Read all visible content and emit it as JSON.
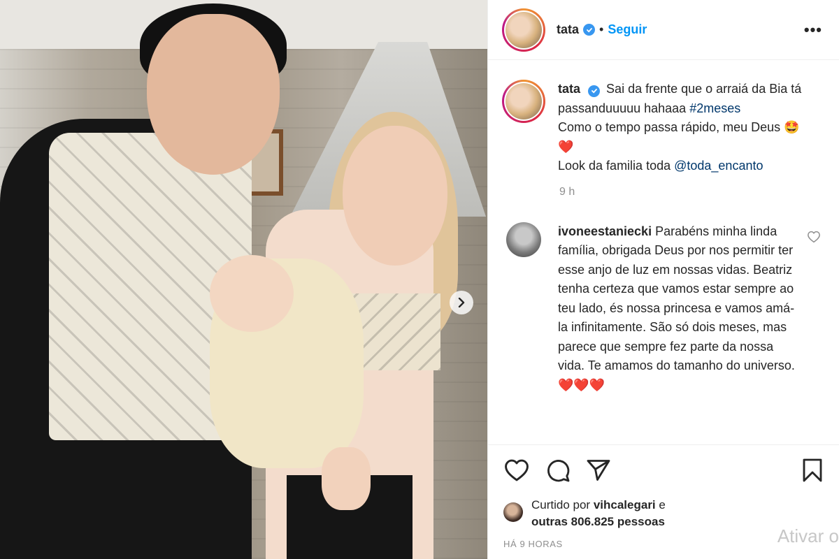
{
  "header": {
    "username": "tata",
    "separator": "•",
    "follow_label": "Seguir",
    "more_label": "•••"
  },
  "caption": {
    "username": "tata",
    "text_part1": "Sai da frente que o arraiá da Bia tá passanduuuuu hahaaa ",
    "hashtag": "#2meses",
    "line2": "Como o tempo passa rápido, meu Deus 🤩❤️",
    "line3_prefix": "Look da familia toda ",
    "mention": "@toda_encanto",
    "time": "9 h"
  },
  "comment": {
    "username": "ivoneestaniecki",
    "text": "Parabéns minha linda família, obrigada Deus por nos permitir ter esse anjo de luz em nossas vidas. Beatriz tenha certeza que vamos estar sempre ao teu lado, és nossa princesa e vamos amá-la infinitamente. São só dois meses, mas parece que sempre fez parte da nossa vida. Te amamos do tamanho do universo. ❤️❤️❤️"
  },
  "likes": {
    "prefix": "Curtido por ",
    "user": "vihcalegari",
    "conj": " e",
    "others": "outras 806.825 pessoas"
  },
  "timestamp": "HÁ 9 HORAS",
  "watermark": "Ativar o",
  "colors": {
    "accent": "#0095f6",
    "verified": "#3897f0",
    "mention": "#00376b",
    "muted": "#8e8e8e"
  }
}
